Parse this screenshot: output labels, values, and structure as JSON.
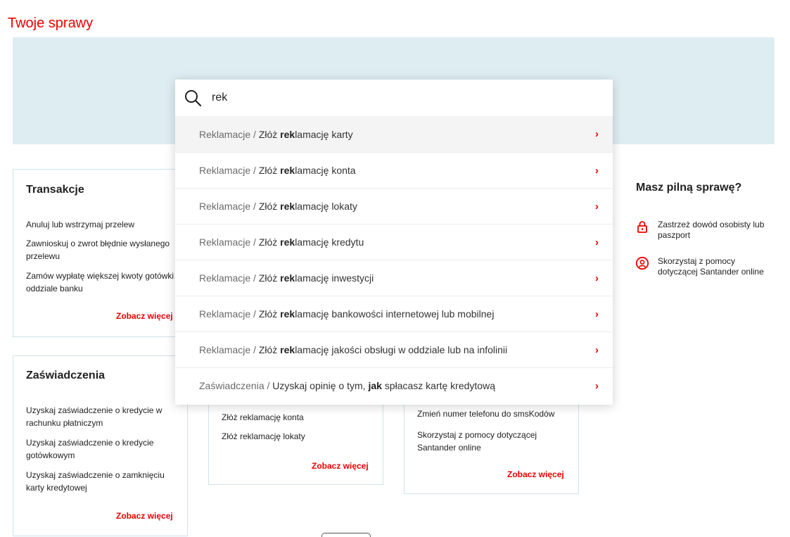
{
  "page": {
    "title": "Twoje sprawy"
  },
  "colors": {
    "accent": "#ec0000",
    "banner": "#deedf2",
    "card_border": "#cfe3ea"
  },
  "search": {
    "value": "rek",
    "icon": "search-icon",
    "results": [
      {
        "category": "Reklamacje / ",
        "pre": "Złóż ",
        "match": "rek",
        "post": "lamację karty",
        "active": true
      },
      {
        "category": "Reklamacje / ",
        "pre": "Złóż ",
        "match": "rek",
        "post": "lamację konta"
      },
      {
        "category": "Reklamacje / ",
        "pre": "Złóż ",
        "match": "rek",
        "post": "lamację lokaty"
      },
      {
        "category": "Reklamacje / ",
        "pre": "Złóż ",
        "match": "rek",
        "post": "lamację kredytu"
      },
      {
        "category": "Reklamacje / ",
        "pre": "Złóż ",
        "match": "rek",
        "post": "lamację inwestycji"
      },
      {
        "category": "Reklamacje / ",
        "pre": "Złóż ",
        "match": "rek",
        "post": "lamację bankowości internetowej lub mobilnej"
      },
      {
        "category": "Reklamacje / ",
        "pre": "Złóż ",
        "match": "rek",
        "post": "lamację jakości obsługi w oddziale lub na infolinii"
      },
      {
        "category": "Zaświadczenia / ",
        "pre": "Uzyskaj opinię o tym, ",
        "match": "jak",
        "post": " spłacasz kartę kredytową"
      }
    ]
  },
  "cards": {
    "transakcje": {
      "title": "Transakcje",
      "links": [
        "Anuluj lub wstrzymaj przelew",
        "Zawnioskuj o zwrot błędnie wysłanego przelewu",
        "Zamów wypłatę większej kwoty gotówki w oddziale banku"
      ],
      "more": "Zobacz więcej"
    },
    "zaswiadczenia": {
      "title": "Zaświadczenia",
      "links": [
        "Uzyskaj zaświadczenie o kredycie w rachunku płatniczym",
        "Uzyskaj zaświadczenie o kredycie gotówkowym",
        "Uzyskaj zaświadczenie o zamknięciu karty kredytowej"
      ],
      "more": "Zobacz więcej"
    },
    "reklamacje": {
      "links": [
        "Złóż reklamację konta",
        "Złóż reklamację lokaty"
      ],
      "more": "Zobacz więcej"
    },
    "pomoc": {
      "links": [
        "Zmień numer telefonu do smsKodów",
        "Skorzystaj z pomocy dotyczącej Santander online"
      ],
      "more": "Zobacz więcej"
    }
  },
  "urgent": {
    "title": "Masz pilną sprawę?",
    "items": [
      {
        "icon": "lock-icon",
        "label": "Zastrzeż dowód osobisty lub paszport"
      },
      {
        "icon": "user-help-icon",
        "label": "Skorzystaj z pomocy dotyczącej Santander online"
      }
    ]
  }
}
